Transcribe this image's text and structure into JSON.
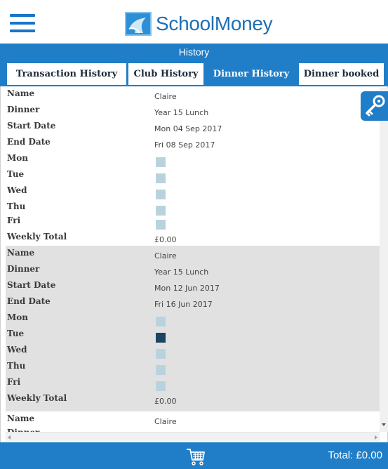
{
  "brand": {
    "part1": "School",
    "part2": "Money"
  },
  "title": "History",
  "tabs": [
    {
      "label": "Transaction History",
      "active": false
    },
    {
      "label": "Club History",
      "active": false
    },
    {
      "label": "Dinner History",
      "active": true
    },
    {
      "label": "Dinner booked",
      "active": false
    }
  ],
  "labels": {
    "name": "Name",
    "dinner": "Dinner",
    "start_date": "Start Date",
    "end_date": "End Date",
    "mon": "Mon",
    "tue": "Tue",
    "wed": "Wed",
    "thu": "Thu",
    "fri": "Fri",
    "weekly_total": "Weekly Total"
  },
  "records": [
    {
      "name": "Claire",
      "dinner": "Year 15 Lunch",
      "start_date": "Mon 04 Sep 2017",
      "end_date": "Fri 08 Sep 2017",
      "days": {
        "mon": false,
        "tue": false,
        "wed": false,
        "thu": false,
        "fri": false
      },
      "weekly_total": "£0.00"
    },
    {
      "name": "Claire",
      "dinner": "Year 15 Lunch",
      "start_date": "Mon 12 Jun 2017",
      "end_date": "Fri 16 Jun 2017",
      "days": {
        "mon": false,
        "tue": true,
        "wed": false,
        "thu": false,
        "fri": false
      },
      "weekly_total": "£0.00"
    },
    {
      "name": "Claire",
      "dinner": "",
      "start_date": "",
      "end_date": "",
      "days": {},
      "weekly_total": ""
    }
  ],
  "footer": {
    "total": "Total: £0.00"
  },
  "icons": {
    "menu": "hamburger-menu-icon",
    "logo": "schoolmoney-logo-icon",
    "key": "key-icon",
    "cart": "shopping-cart-icon"
  },
  "colors": {
    "accent": "#1f7ec7",
    "brand_text": "#1d6fb5",
    "checked_day": "#1b4460",
    "unchecked_day": "#b9d3de",
    "shaded_record": "#e1e1e1"
  }
}
